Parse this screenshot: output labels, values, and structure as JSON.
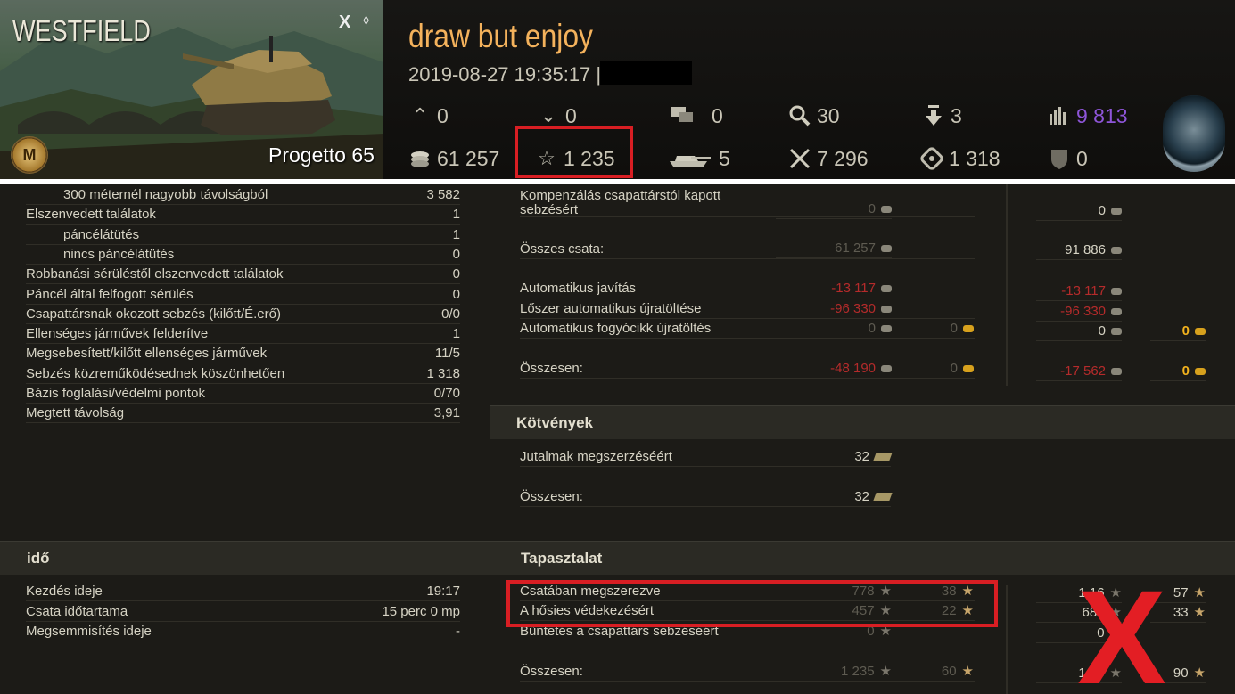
{
  "header": {
    "map_name": "WESTFIELD",
    "tier": "X",
    "medal_letter": "M",
    "tank_name": "Progetto 65",
    "battle_title": "draw but enjoy",
    "battle_time": "2019-08-27 19:35:17 |",
    "stats": {
      "shots_up": "0",
      "shots_down": "0",
      "messages": "0",
      "spotted": "30",
      "captures": "3",
      "rating": "9 813",
      "credits": "61 257",
      "xp": "1 235",
      "kills": "5",
      "damage": "7 296",
      "assist": "1 318",
      "blocked": "0"
    },
    "colors": {
      "title": "#f4b25c",
      "rating": "#8e55d8",
      "highlight": "#d81e23"
    }
  },
  "left_stats": [
    {
      "label": "300 méternél nagyobb távolságból",
      "value": "3 582",
      "indent": true
    },
    {
      "label": "Elszenvedett találatok",
      "value": "1",
      "indent": false
    },
    {
      "label": "páncélátütés",
      "value": "1",
      "indent": true
    },
    {
      "label": "nincs páncélátütés",
      "value": "0",
      "indent": true
    },
    {
      "label": "Robbanási sérüléstől elszenvedett találatok",
      "value": "0",
      "indent": false
    },
    {
      "label": "Páncél által felfogott sérülés",
      "value": "0",
      "indent": false
    },
    {
      "label": "Csapattársnak okozott sebzés (kilőtt/É.erő)",
      "value": "0/0",
      "indent": false
    },
    {
      "label": "Ellenséges járművek felderítve",
      "value": "1",
      "indent": false
    },
    {
      "label": "Megsebesített/kilőtt ellenséges járművek",
      "value": "11/5",
      "indent": false
    },
    {
      "label": "Sebzés közreműködésednek köszönhetően",
      "value": "1 318",
      "indent": false
    },
    {
      "label": "Bázis foglalási/védelmi pontok",
      "value": "0/70",
      "indent": false
    },
    {
      "label": "Megtett távolság",
      "value": "3,91",
      "indent": false
    }
  ],
  "credits": {
    "comp_label_1": "Kompenzálás csapattárstól kapott",
    "comp_label_2": "sebzésért",
    "comp_a": "0",
    "comp_c": "0",
    "total_label": "Összes csata:",
    "total_a": "61 257",
    "total_c": "91 886",
    "repair_label": "Automatikus javítás",
    "repair_a": "-13 117",
    "repair_c": "-13 117",
    "ammo_label": "Lőszer automatikus újratöltése",
    "ammo_a": "-96 330",
    "ammo_c": "-96 330",
    "consum_label": "Automatikus fogyócikk újratöltés",
    "consum_a": "0",
    "consum_b": "0",
    "consum_c": "0",
    "consum_d": "0",
    "sum_label": "Összesen:",
    "sum_a": "-48 190",
    "sum_b": "0",
    "sum_c": "-17 562",
    "sum_d": "0"
  },
  "bonds": {
    "title": "Kötvények",
    "reward_label": "Jutalmak megszerzéséért",
    "reward_value": "32",
    "sum_label": "Összesen:",
    "sum_value": "32"
  },
  "time": {
    "title": "idő",
    "rows": [
      {
        "label": "Kezdés ideje",
        "value": "19:17"
      },
      {
        "label": "Csata időtartama",
        "value": "15 perc 0 mp"
      },
      {
        "label": "Megsemmisítés ideje",
        "value": "-"
      }
    ]
  },
  "xp": {
    "title": "Tapasztalat",
    "battle_label": "Csatában megszerezve",
    "battle_a": "778",
    "battle_b": "38",
    "battle_c": "1 16",
    "battle_d": "57",
    "hero_label": "A hősies védekezésért",
    "hero_a": "457",
    "hero_b": "22",
    "hero_c": "685",
    "hero_d": "33",
    "penalty_label": "Büntetés a csapattárs sebzéséért",
    "penalty_a": "0",
    "penalty_c": "0",
    "sum_label": "Összesen:",
    "sum_a": "1 235",
    "sum_b": "60",
    "sum_c": "1 85",
    "sum_d": "90"
  },
  "annotation": {
    "mark": "X"
  }
}
